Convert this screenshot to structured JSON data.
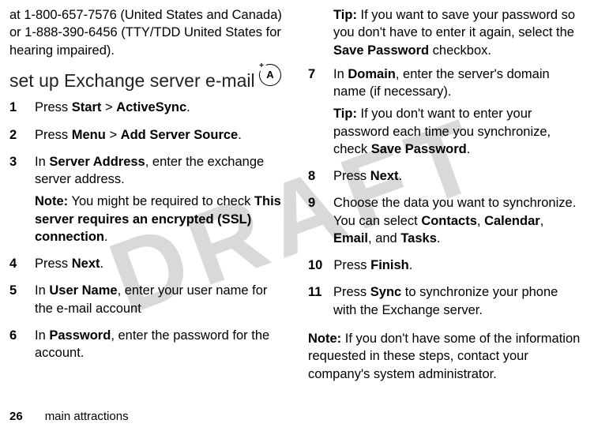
{
  "watermark": "DRAFT",
  "col1": {
    "intro": "at 1-800-657-7576 (United States and Canada) or 1-888-390-6456 (TTY/TDD United States for hearing impaired).",
    "heading": "set up Exchange server e-mail",
    "icon_letter": "A",
    "steps": {
      "s1": {
        "num": "1",
        "pre": "Press ",
        "b1": "Start",
        "gt": " > ",
        "b2": "ActiveSync",
        "post": "."
      },
      "s2": {
        "num": "2",
        "pre": "Press ",
        "b1": "Menu",
        "gt": " > ",
        "b2": "Add Server Source",
        "post": "."
      },
      "s3": {
        "num": "3",
        "pre": "In ",
        "b1": "Server Address",
        "post1": ", enter the exchange server address.",
        "note_lead": "Note:",
        "note_text": " You might be required to check ",
        "note_b": "This server requires an encrypted (SSL) connection",
        "note_post": "."
      },
      "s4": {
        "num": "4",
        "pre": "Press ",
        "b1": "Next",
        "post": "."
      },
      "s5": {
        "num": "5",
        "pre": "In ",
        "b1": "User Name",
        "post": ", enter your user name for the e-mail account"
      },
      "s6": {
        "num": "6",
        "pre": "In ",
        "b1": "Password",
        "post": ", enter the password for the account."
      }
    }
  },
  "col2": {
    "tip1": {
      "lead": "Tip:",
      "text": " If you want to save your password so you don't have to enter it again, select the ",
      "b": "Save Password",
      "post": " checkbox."
    },
    "s7": {
      "num": "7",
      "pre": "In ",
      "b1": "Domain",
      "post1": ", enter the server's domain name (if necessary).",
      "tip_lead": "Tip:",
      "tip_text": " If you don't want to enter your password each time you synchronize, check ",
      "tip_b": "Save Password",
      "tip_post": "."
    },
    "s8": {
      "num": "8",
      "pre": "Press ",
      "b1": "Next",
      "post": "."
    },
    "s9": {
      "num": "9",
      "text1": "Choose the data you want to synchronize. You can select ",
      "b1": "Contacts",
      "c1": ", ",
      "b2": "Calendar",
      "c2": ", ",
      "b3": "Email",
      "c3": ", and ",
      "b4": "Tasks",
      "post": "."
    },
    "s10": {
      "num": "10",
      "pre": "Press ",
      "b1": "Finish",
      "post": "."
    },
    "s11": {
      "num": "11",
      "pre": "Press ",
      "b1": "Sync",
      "post": " to synchronize your phone with the Exchange server."
    },
    "bottom_note": {
      "lead": "Note:",
      "text": " If you don't have some of the information requested in these steps, contact your company's system administrator."
    }
  },
  "footer": {
    "page": "26",
    "section": "main attractions"
  }
}
